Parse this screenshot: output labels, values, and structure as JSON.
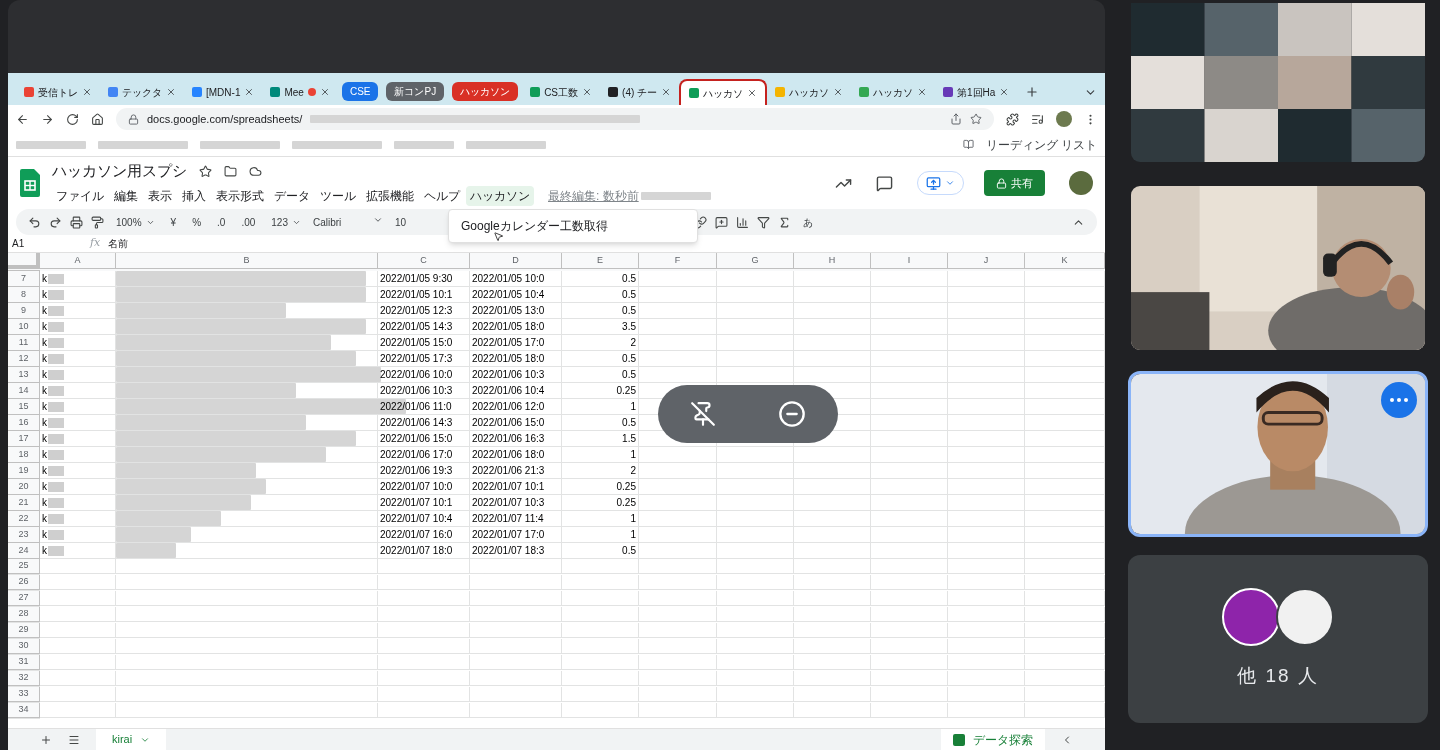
{
  "browser": {
    "tabs": [
      {
        "kind": "page",
        "label": "受信トレ",
        "color": "#ea4335",
        "recording": false,
        "selected": false
      },
      {
        "kind": "page",
        "label": "テックタ",
        "color": "#4285f4",
        "recording": false,
        "selected": false
      },
      {
        "kind": "page",
        "label": "[MDN-1",
        "color": "#2684ff",
        "recording": false,
        "selected": false
      },
      {
        "kind": "page",
        "label": "Mee",
        "color": "#00897b",
        "recording": true,
        "selected": false
      },
      {
        "kind": "group",
        "label": "CSE",
        "color": "#1a73e8"
      },
      {
        "kind": "group",
        "label": "新コンPJ",
        "color": "#5f6368"
      },
      {
        "kind": "group",
        "label": "ハッカソン",
        "color": "#d93025"
      },
      {
        "kind": "page",
        "label": "CS工数",
        "color": "#0f9d58",
        "recording": false,
        "selected": false
      },
      {
        "kind": "page",
        "label": "(4) チー",
        "color": "#202124",
        "recording": false,
        "selected": false
      },
      {
        "kind": "page",
        "label": "ハッカソ",
        "color": "#0f9d58",
        "recording": false,
        "selected": true
      },
      {
        "kind": "page",
        "label": "ハッカソ",
        "color": "#f4b400",
        "recording": false,
        "selected": false
      },
      {
        "kind": "page",
        "label": "ハッカソ",
        "color": "#34a853",
        "recording": false,
        "selected": false
      },
      {
        "kind": "page",
        "label": "第1回Ha",
        "color": "#673ab7",
        "recording": false,
        "selected": false
      }
    ],
    "url": "docs.google.com/spreadsheets/",
    "reading_list": "リーディング リスト"
  },
  "sheet": {
    "title": "ハッカソン用スプシ",
    "menus": [
      {
        "label": "ファイル",
        "selected": false
      },
      {
        "label": "編集",
        "selected": false
      },
      {
        "label": "表示",
        "selected": false
      },
      {
        "label": "挿入",
        "selected": false
      },
      {
        "label": "表示形式",
        "selected": false
      },
      {
        "label": "データ",
        "selected": false
      },
      {
        "label": "ツール",
        "selected": false
      },
      {
        "label": "拡張機能",
        "selected": false
      },
      {
        "label": "ヘルプ",
        "selected": false
      },
      {
        "label": "ハッカソン",
        "selected": true
      }
    ],
    "last_edit": "最終編集: 数秒前",
    "share": "共有",
    "toolbar": {
      "zoom": "100%",
      "currency": "¥",
      "percent": "%",
      "decrease_decimal": ".0",
      "increase_decimal": ".00",
      "format": "123",
      "font": "Calibri",
      "size": "10",
      "input_tools": "あ"
    },
    "dropdown": {
      "items": [
        "Googleカレンダー工数取得"
      ]
    },
    "cell_ref": "A1",
    "fx": "fx",
    "formula": "名前",
    "columns": [
      "A",
      "B",
      "C",
      "D",
      "E",
      "F",
      "G",
      "H",
      "I",
      "J",
      "K"
    ],
    "rows": [
      {
        "number": "7",
        "a": "k",
        "c": "2022/01/05 9:30",
        "d": "2022/01/05 10:0",
        "e": "0.5"
      },
      {
        "number": "8",
        "a": "k",
        "c": "2022/01/05 10:1",
        "d": "2022/01/05 10:4",
        "e": "0.5"
      },
      {
        "number": "9",
        "a": "k",
        "c": "2022/01/05 12:3",
        "d": "2022/01/05 13:0",
        "e": "0.5"
      },
      {
        "number": "10",
        "a": "k",
        "c": "2022/01/05 14:3",
        "d": "2022/01/05 18:0",
        "e": "3.5"
      },
      {
        "number": "11",
        "a": "k",
        "c": "2022/01/05 15:0",
        "d": "2022/01/05 17:0",
        "e": "2"
      },
      {
        "number": "12",
        "a": "k",
        "c": "2022/01/05 17:3",
        "d": "2022/01/05 18:0",
        "e": "0.5"
      },
      {
        "number": "13",
        "a": "k",
        "c": "2022/01/06 10:0",
        "d": "2022/01/06 10:3",
        "e": "0.5"
      },
      {
        "number": "14",
        "a": "k",
        "c": "2022/01/06 10:3",
        "d": "2022/01/06 10:4",
        "e": "0.25"
      },
      {
        "number": "15",
        "a": "k",
        "c": "2022/01/06 11:0",
        "d": "2022/01/06 12:0",
        "e": "1"
      },
      {
        "number": "16",
        "a": "k",
        "c": "2022/01/06 14:3",
        "d": "2022/01/06 15:0",
        "e": "0.5"
      },
      {
        "number": "17",
        "a": "k",
        "c": "2022/01/06 15:0",
        "d": "2022/01/06 16:3",
        "e": "1.5"
      },
      {
        "number": "18",
        "a": "k",
        "c": "2022/01/06 17:0",
        "d": "2022/01/06 18:0",
        "e": "1"
      },
      {
        "number": "19",
        "a": "k",
        "c": "2022/01/06 19:3",
        "d": "2022/01/06 21:3",
        "e": "2"
      },
      {
        "number": "20",
        "a": "k",
        "c": "2022/01/07 10:0",
        "d": "2022/01/07 10:1",
        "e": "0.25"
      },
      {
        "number": "21",
        "a": "k",
        "c": "2022/01/07 10:1",
        "d": "2022/01/07 10:3",
        "e": "0.25"
      },
      {
        "number": "22",
        "a": "k",
        "c": "2022/01/07 10:4",
        "d": "2022/01/07 11:4",
        "e": "1"
      },
      {
        "number": "23",
        "a": "k",
        "c": "2022/01/07 16:0",
        "d": "2022/01/07 17:0",
        "e": "1"
      },
      {
        "number": "24",
        "a": "k",
        "c": "2022/01/07 18:0",
        "d": "2022/01/07 18:3",
        "e": "0.5"
      }
    ],
    "empty_rows": [
      "25",
      "26",
      "27",
      "28",
      "29",
      "30",
      "31",
      "32",
      "33",
      "34"
    ],
    "sheet_tabs": [
      {
        "label": "kirai",
        "selected": true
      }
    ],
    "explore": "データ探索"
  },
  "meeting": {
    "tiles": [
      {
        "kind": "picture",
        "speaking": false
      },
      {
        "kind": "picture",
        "speaking": false
      },
      {
        "kind": "picture",
        "speaking": true
      },
      {
        "kind": "others",
        "label": "他 18 人"
      }
    ]
  }
}
